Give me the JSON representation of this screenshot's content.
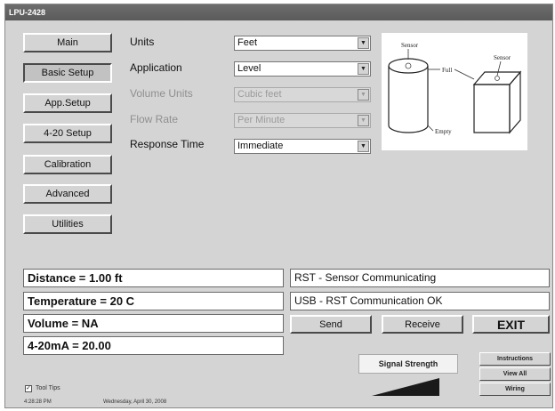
{
  "window": {
    "title": "LPU-2428"
  },
  "nav": [
    {
      "label": "Main",
      "active": false
    },
    {
      "label": "Basic Setup",
      "active": true
    },
    {
      "label": "App.Setup",
      "active": false
    },
    {
      "label": "4-20 Setup",
      "active": false
    },
    {
      "label": "Calibration",
      "active": false
    },
    {
      "label": "Advanced",
      "active": false
    },
    {
      "label": "Utilities",
      "active": false
    }
  ],
  "settings": [
    {
      "label": "Units",
      "value": "Feet",
      "enabled": true
    },
    {
      "label": "Application",
      "value": "Level",
      "enabled": true
    },
    {
      "label": "Volume Units",
      "value": "Cubic feet",
      "enabled": false
    },
    {
      "label": "Flow Rate",
      "value": "Per Minute",
      "enabled": false
    },
    {
      "label": "Response Time",
      "value": "Immediate",
      "enabled": true
    }
  ],
  "diagram": {
    "sensor_left": "Sensor",
    "sensor_right": "Sensor",
    "full": "Full",
    "empty": "Empty"
  },
  "readings": {
    "distance": "Distance = 1.00 ft",
    "temperature": "Temperature = 20 C",
    "volume": "Volume = NA",
    "current": "4-20mA = 20.00"
  },
  "status": {
    "sensor": "RST - Sensor Communicating",
    "usb": "USB - RST Communication OK"
  },
  "buttons": {
    "send": "Send",
    "receive": "Receive",
    "exit": "EXIT",
    "instructions": "Instructions",
    "view_all": "View All",
    "wiring": "Wiring"
  },
  "signal": {
    "label": "Signal Strength",
    "level": 1.0
  },
  "footer": {
    "tool_tips": "Tool Tips",
    "tool_tips_checked": true,
    "time": "4:28:28 PM",
    "date": "Wednesday, April 30, 2008"
  },
  "colors": {
    "window_bg": "#d4d4d4",
    "titlebar": "#5e5e5e",
    "signal_bar": "#1a1a1a"
  }
}
